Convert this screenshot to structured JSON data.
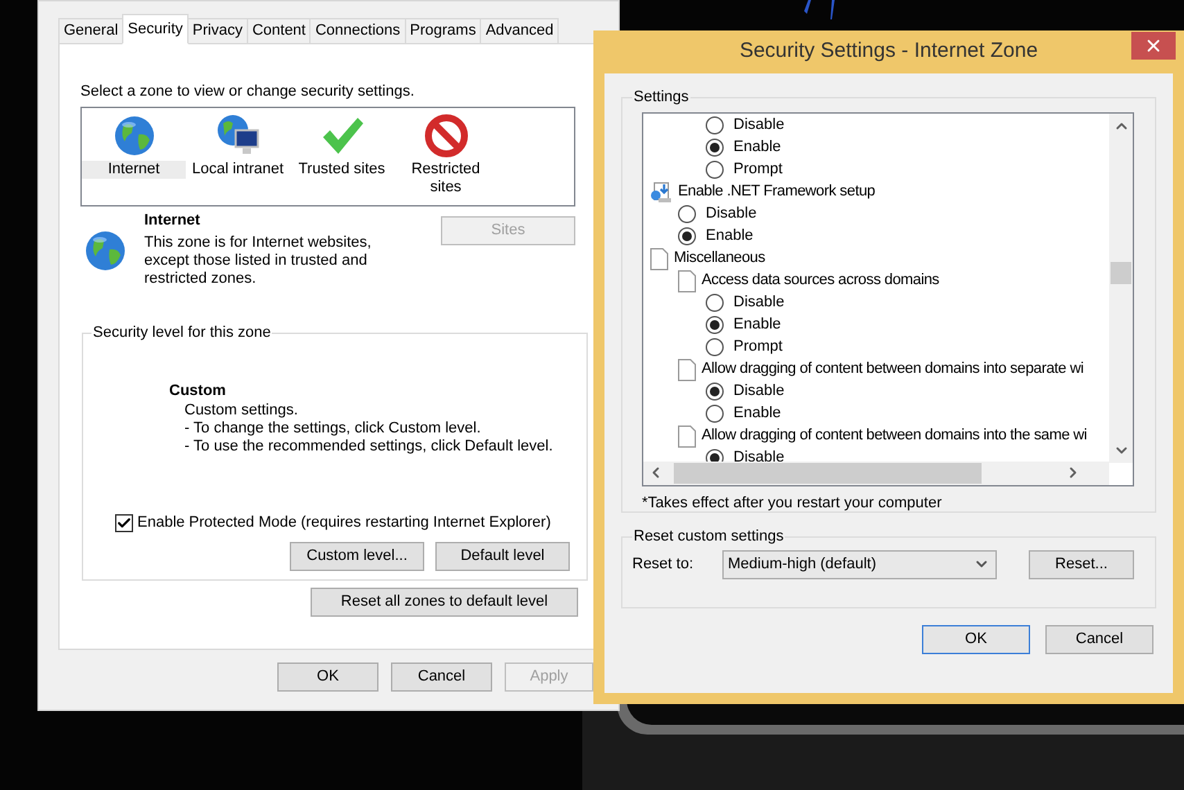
{
  "main_window": {
    "tabs": [
      {
        "label": "General",
        "selected": false
      },
      {
        "label": "Security",
        "selected": true
      },
      {
        "label": "Privacy",
        "selected": false
      },
      {
        "label": "Content",
        "selected": false
      },
      {
        "label": "Connections",
        "selected": false
      },
      {
        "label": "Programs",
        "selected": false
      },
      {
        "label": "Advanced",
        "selected": false
      }
    ],
    "instruction": "Select a zone to view or change security settings.",
    "zones": [
      {
        "label": "Internet",
        "kind": "globe",
        "selected": true
      },
      {
        "label": "Local intranet",
        "kind": "intranet",
        "selected": false
      },
      {
        "label": "Trusted sites",
        "kind": "trusted",
        "selected": false
      },
      {
        "label": "Restricted sites",
        "kind": "restricted",
        "selected": false
      }
    ],
    "zone_detail": {
      "title": "Internet",
      "description": "This zone is for Internet websites, except those listed in trusted and restricted zones.",
      "sites_button": {
        "label": "Sites",
        "disabled": true
      }
    },
    "security_level": {
      "legend": "Security level for this zone",
      "level_name": "Custom",
      "lines": [
        "Custom settings.",
        "- To change the settings, click Custom level.",
        "- To use the recommended settings, click Default level."
      ],
      "protected_mode": {
        "label": "Enable Protected Mode (requires restarting Internet Explorer)",
        "checked": true
      },
      "buttons": [
        "Custom level...",
        "Default level"
      ]
    },
    "reset_all_button": "Reset all zones to default level",
    "buttons": [
      {
        "label": "OK",
        "disabled": false
      },
      {
        "label": "Cancel",
        "disabled": false
      },
      {
        "label": "Apply",
        "disabled": true
      }
    ]
  },
  "settings_dialog": {
    "title": "Security Settings - Internet Zone",
    "legend": "Settings",
    "items": [
      {
        "kind": "scrolled",
        "children": [
          {
            "kind": "scrolled",
            "children": [
              {
                "kind": "radio",
                "label": "Disable",
                "selected": false
              },
              {
                "kind": "radio",
                "label": "Enable",
                "selected": true
              },
              {
                "kind": "radio",
                "label": "Prompt",
                "selected": false
              }
            ]
          }
        ]
      },
      {
        "kind": "installer",
        "label": "Enable .NET Framework setup",
        "children": [
          {
            "kind": "radio",
            "label": "Disable",
            "selected": false
          },
          {
            "kind": "radio",
            "label": "Enable",
            "selected": true
          }
        ]
      },
      {
        "kind": "page",
        "label": "Miscellaneous",
        "children": [
          {
            "kind": "page",
            "label": "Access data sources across domains",
            "children": [
              {
                "kind": "radio",
                "label": "Disable",
                "selected": false
              },
              {
                "kind": "radio",
                "label": "Enable",
                "selected": true
              },
              {
                "kind": "radio",
                "label": "Prompt",
                "selected": false
              }
            ]
          },
          {
            "kind": "page",
            "label": "Allow dragging of content between domains into separate wi",
            "children": [
              {
                "kind": "radio",
                "label": "Disable",
                "selected": true
              },
              {
                "kind": "radio",
                "label": "Enable",
                "selected": false
              }
            ]
          },
          {
            "kind": "page",
            "label": "Allow dragging of content between domains into the same wi",
            "children": [
              {
                "kind": "radio",
                "label": "Disable",
                "selected": true
              }
            ]
          }
        ]
      }
    ],
    "footnote": "*Takes effect after you restart your computer",
    "reset_group": {
      "legend": "Reset custom settings",
      "label": "Reset to:",
      "value": "Medium-high (default)",
      "button": "Reset..."
    },
    "buttons": [
      {
        "label": "OK",
        "focused": true
      },
      {
        "label": "Cancel",
        "focused": false
      }
    ]
  }
}
